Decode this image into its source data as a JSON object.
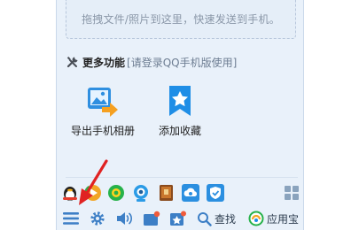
{
  "drop_area": {
    "hint": "拖拽文件/照片到这里，快速发送到手机。"
  },
  "more_functions": {
    "icon": "tools-icon",
    "title": "更多功能",
    "note": "[请登录QQ手机版使用]"
  },
  "features": [
    {
      "icon": "export-photos-icon",
      "label": "导出手机相册"
    },
    {
      "icon": "bookmark-star-icon",
      "label": "添加收藏"
    }
  ],
  "app_icons": [
    "qq-game-icon",
    "video-play-icon",
    "green-circle-icon",
    "webcam-icon",
    "book-icon",
    "cloud-sync-icon",
    "shield-icon",
    "app-grid-icon"
  ],
  "toolbar": {
    "menu_icon": "main-menu-icon",
    "settings_icon": "gear-icon",
    "volume_icon": "speaker-icon",
    "messages_icon": "message-box-icon",
    "favorites_icon": "favorite-star-icon",
    "search_label": "查找",
    "app_store_label": "应用宝"
  },
  "colors": {
    "panel_bg": "#e9f1fa",
    "accent": "#1f8ee6",
    "annotation": "#e02222"
  }
}
